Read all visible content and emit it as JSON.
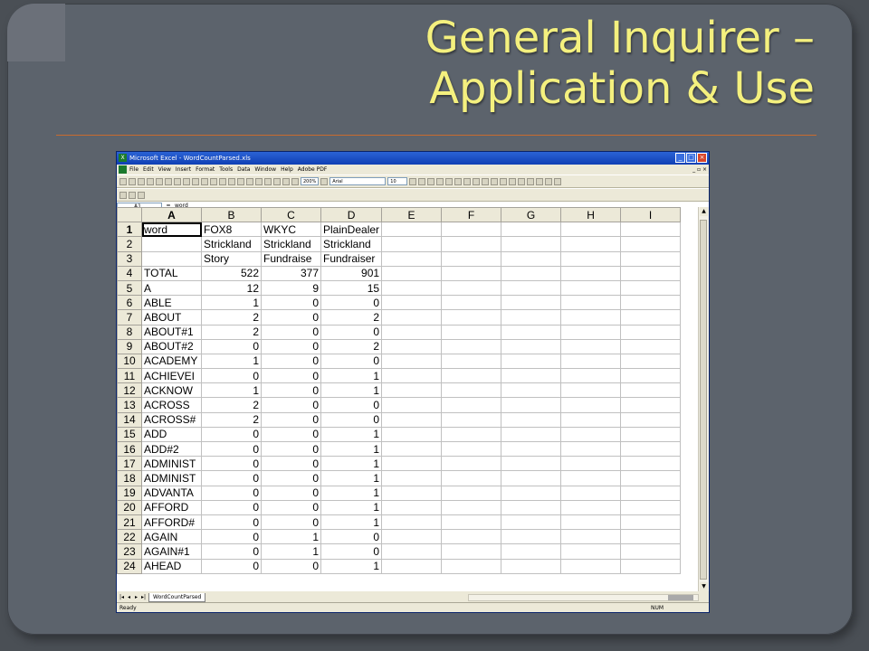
{
  "slide": {
    "title_line1": "General Inquirer –",
    "title_line2": "Application & Use"
  },
  "window": {
    "title": "Microsoft Excel - WordCountParsed.xls",
    "menu": [
      "File",
      "Edit",
      "View",
      "Insert",
      "Format",
      "Tools",
      "Data",
      "Window",
      "Help",
      "Adobe PDF"
    ],
    "zoom": "200%",
    "font": "Arial",
    "font_size": "10",
    "namebox": "A1",
    "formula": "word"
  },
  "sheet": {
    "columns": [
      "A",
      "B",
      "C",
      "D",
      "E",
      "F",
      "G",
      "H",
      "I"
    ],
    "rows": [
      {
        "n": "1",
        "a": "word",
        "b": "FOX8",
        "c": "WKYC",
        "d": "PlainDealer"
      },
      {
        "n": "2",
        "a": "",
        "b": "Strickland",
        "c": "Strickland",
        "d": "Strickland"
      },
      {
        "n": "3",
        "a": "",
        "b": "Story",
        "c": "Fundraise",
        "d": "Fundraiser"
      },
      {
        "n": "4",
        "a": "TOTAL",
        "b": "522",
        "c": "377",
        "d": "901"
      },
      {
        "n": "5",
        "a": "A",
        "b": "12",
        "c": "9",
        "d": "15"
      },
      {
        "n": "6",
        "a": "ABLE",
        "b": "1",
        "c": "0",
        "d": "0"
      },
      {
        "n": "7",
        "a": "ABOUT",
        "b": "2",
        "c": "0",
        "d": "2"
      },
      {
        "n": "8",
        "a": "ABOUT#1",
        "b": "2",
        "c": "0",
        "d": "0"
      },
      {
        "n": "9",
        "a": "ABOUT#2",
        "b": "0",
        "c": "0",
        "d": "2"
      },
      {
        "n": "10",
        "a": "ACADEMY",
        "b": "1",
        "c": "0",
        "d": "0"
      },
      {
        "n": "11",
        "a": "ACHIEVEI",
        "b": "0",
        "c": "0",
        "d": "1"
      },
      {
        "n": "12",
        "a": "ACKNOW",
        "b": "1",
        "c": "0",
        "d": "1"
      },
      {
        "n": "13",
        "a": "ACROSS",
        "b": "2",
        "c": "0",
        "d": "0"
      },
      {
        "n": "14",
        "a": "ACROSS#",
        "b": "2",
        "c": "0",
        "d": "0"
      },
      {
        "n": "15",
        "a": "ADD",
        "b": "0",
        "c": "0",
        "d": "1"
      },
      {
        "n": "16",
        "a": "ADD#2",
        "b": "0",
        "c": "0",
        "d": "1"
      },
      {
        "n": "17",
        "a": "ADMINIST",
        "b": "0",
        "c": "0",
        "d": "1"
      },
      {
        "n": "18",
        "a": "ADMINIST",
        "b": "0",
        "c": "0",
        "d": "1"
      },
      {
        "n": "19",
        "a": "ADVANTA",
        "b": "0",
        "c": "0",
        "d": "1"
      },
      {
        "n": "20",
        "a": "AFFORD",
        "b": "0",
        "c": "0",
        "d": "1"
      },
      {
        "n": "21",
        "a": "AFFORD#",
        "b": "0",
        "c": "0",
        "d": "1"
      },
      {
        "n": "22",
        "a": "AGAIN",
        "b": "0",
        "c": "1",
        "d": "0"
      },
      {
        "n": "23",
        "a": "AGAIN#1",
        "b": "0",
        "c": "1",
        "d": "0"
      },
      {
        "n": "24",
        "a": "AHEAD",
        "b": "0",
        "c": "0",
        "d": "1"
      }
    ],
    "tab": "WordCountParsed",
    "status_left": "Ready",
    "status_num": "NUM"
  }
}
